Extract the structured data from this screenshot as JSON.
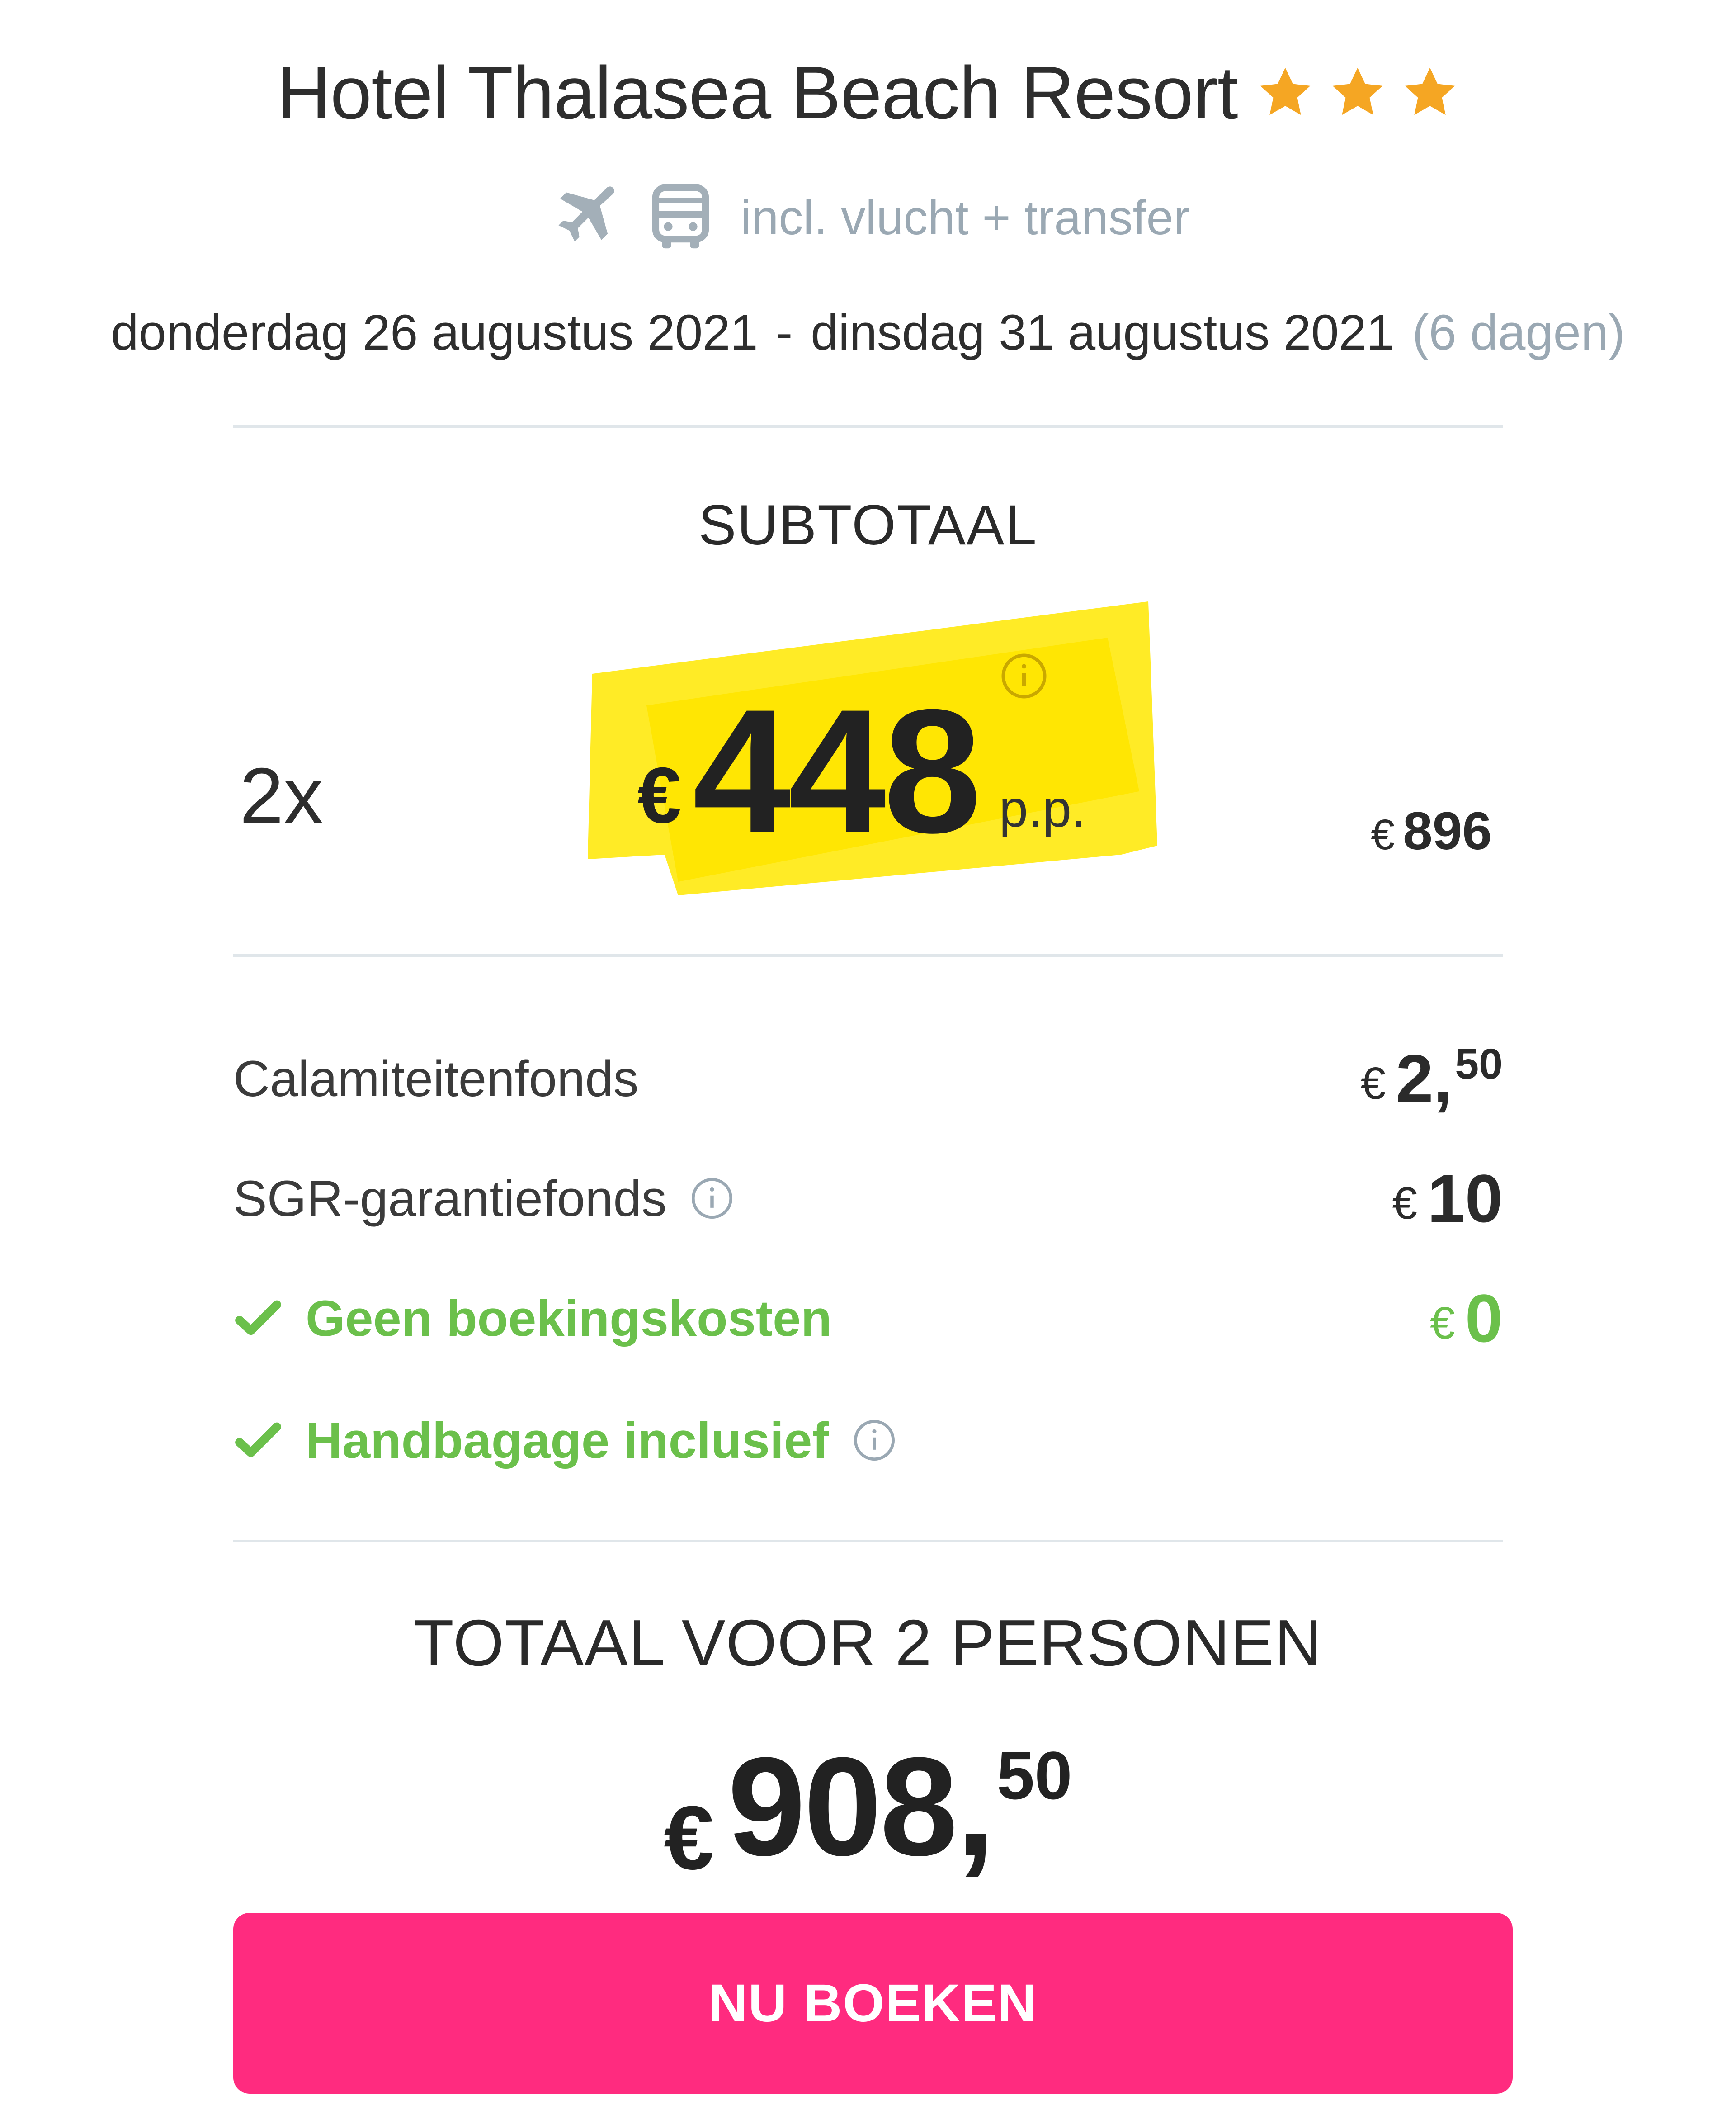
{
  "hotel": {
    "name": "Hotel Thalasea Beach Resort",
    "star_rating": 3,
    "stars": [
      "star-icon",
      "star-icon",
      "star-icon"
    ],
    "star_color": "#f5a623"
  },
  "includes": {
    "icons": [
      "airplane-icon",
      "bus-icon"
    ],
    "text": "incl. vlucht + transfer"
  },
  "dates": {
    "start": "donderdag 26 augustus 2021",
    "separator": "-",
    "end": "dinsdag 31 augustus 2021",
    "duration": "(6 dagen)"
  },
  "subtotal": {
    "label": "SUBTOTAAL",
    "quantity": "2x",
    "currency": "€",
    "price_per_person": "448",
    "per_person_label": "p.p.",
    "total_currency": "€",
    "total": "896",
    "highlight_color": "#ffe600"
  },
  "fees": {
    "calamity": {
      "label": "Calamiteitenfonds",
      "currency": "€",
      "amount": "2,",
      "decimals": "50"
    },
    "sgr": {
      "label": "SGR-garantiefonds",
      "currency": "€",
      "amount": "10"
    },
    "booking_costs": {
      "label": "Geen boekingskosten",
      "currency": "€",
      "amount": "0"
    },
    "hand_luggage": {
      "label": "Handbagage inclusief"
    },
    "included_color": "#6bc04b"
  },
  "total": {
    "label": "TOTAAL VOOR 2 PERSONEN",
    "currency": "€",
    "amount": "908,",
    "decimals": "50"
  },
  "cta": {
    "label": "NU BOEKEN",
    "color": "#ff2b7f"
  }
}
